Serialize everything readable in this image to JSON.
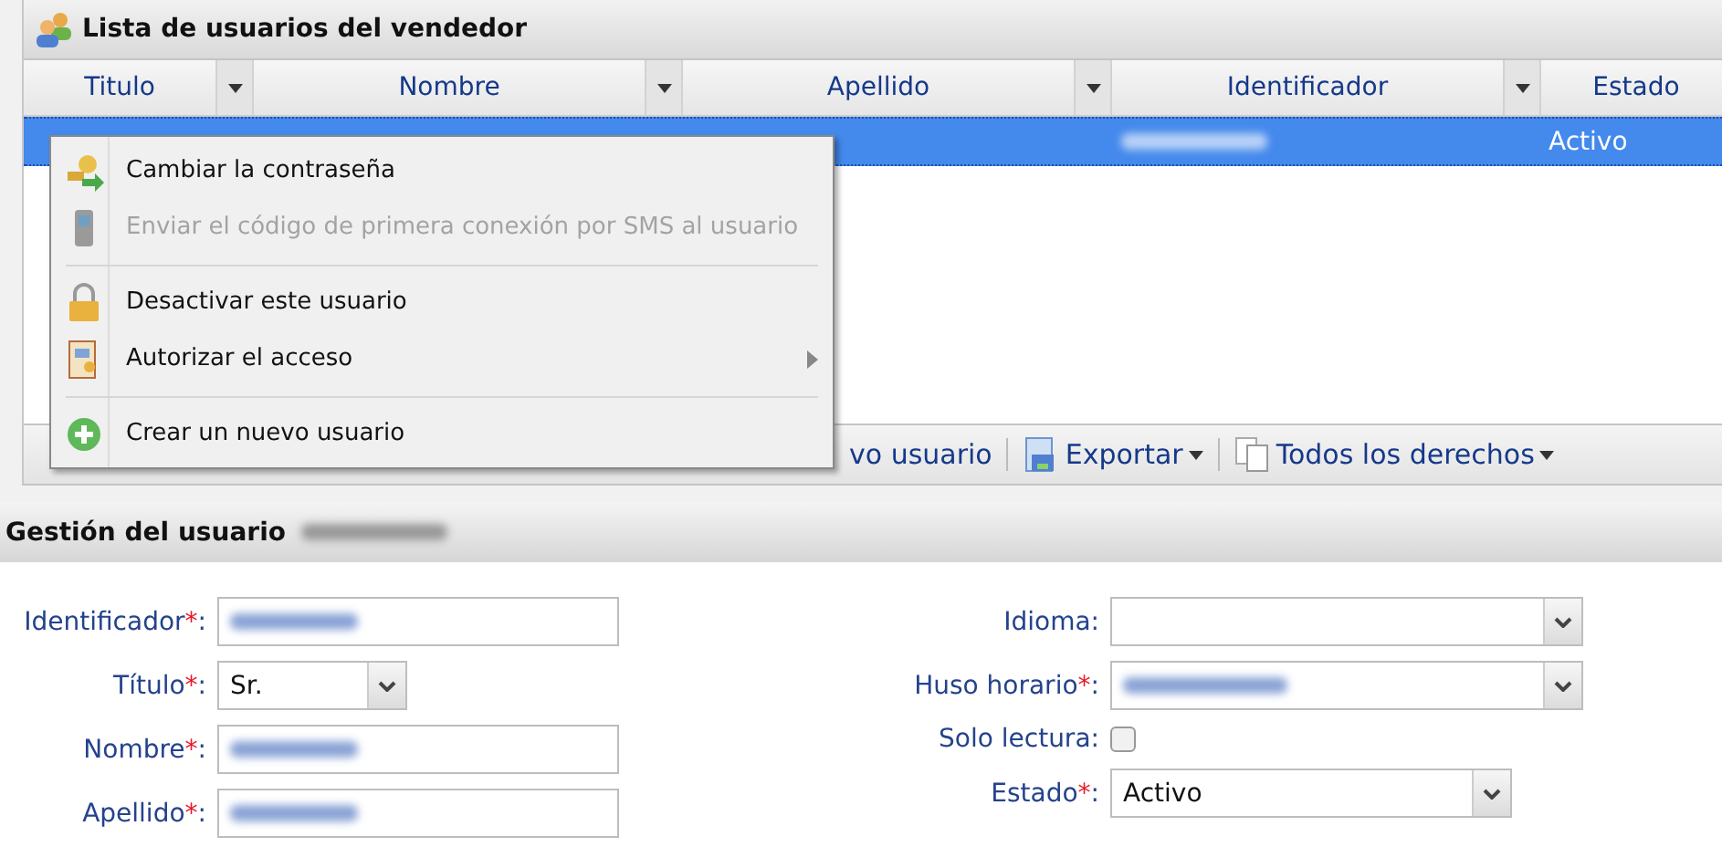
{
  "grid": {
    "title": "Lista de usuarios del vendedor",
    "columns": [
      {
        "label": "Titulo"
      },
      {
        "label": "Nombre"
      },
      {
        "label": "Apellido"
      },
      {
        "label": "Identificador"
      },
      {
        "label": "Estado"
      }
    ],
    "rows": [
      {
        "selected": true,
        "identifier_blurred": true,
        "status": "Activo"
      }
    ],
    "toolbar": [
      {
        "label": "vo usuario",
        "kind": "plain"
      },
      {
        "label": "Exportar",
        "kind": "export"
      },
      {
        "label": "Todos los derechos",
        "kind": "rights"
      }
    ]
  },
  "context_menu": {
    "items": [
      {
        "kind": "item",
        "label": "Cambiar la contraseña",
        "disabled": false,
        "submenu": false
      },
      {
        "kind": "item",
        "label": "Enviar el código de primera conexión por SMS al usuario",
        "disabled": true,
        "submenu": false
      },
      {
        "kind": "separator"
      },
      {
        "kind": "item",
        "label": "Desactivar este usuario",
        "disabled": false,
        "submenu": false
      },
      {
        "kind": "item",
        "label": "Autorizar el acceso",
        "disabled": false,
        "submenu": true
      },
      {
        "kind": "separator"
      },
      {
        "kind": "item",
        "label": "Crear un nuevo usuario",
        "disabled": false,
        "submenu": false
      }
    ]
  },
  "form": {
    "title": "Gestión del usuario",
    "title_blurred": true,
    "left": [
      {
        "label": "Identificador",
        "required_mark": "*",
        "colon": ":",
        "kind": "text",
        "blurred": true
      },
      {
        "label": "Título",
        "required_mark": "*",
        "colon": ":",
        "kind": "select",
        "value": "Sr."
      },
      {
        "label": "Nombre",
        "required_mark": "*",
        "colon": ":",
        "kind": "text",
        "blurred": true
      },
      {
        "label": "Apellido",
        "required_mark": "*",
        "colon": ":",
        "kind": "text",
        "blurred": true
      }
    ],
    "right": [
      {
        "label": "Idioma",
        "colon": ":",
        "kind": "select"
      },
      {
        "label": "Huso horario",
        "required_mark": "*",
        "colon": ":",
        "kind": "select",
        "blurred": true
      },
      {
        "label": "Solo lectura",
        "colon": ":",
        "kind": "checkbox",
        "checked": false
      },
      {
        "label": "Estado",
        "required_mark": "*",
        "colon": ":",
        "kind": "select",
        "value": "Activo"
      }
    ]
  }
}
